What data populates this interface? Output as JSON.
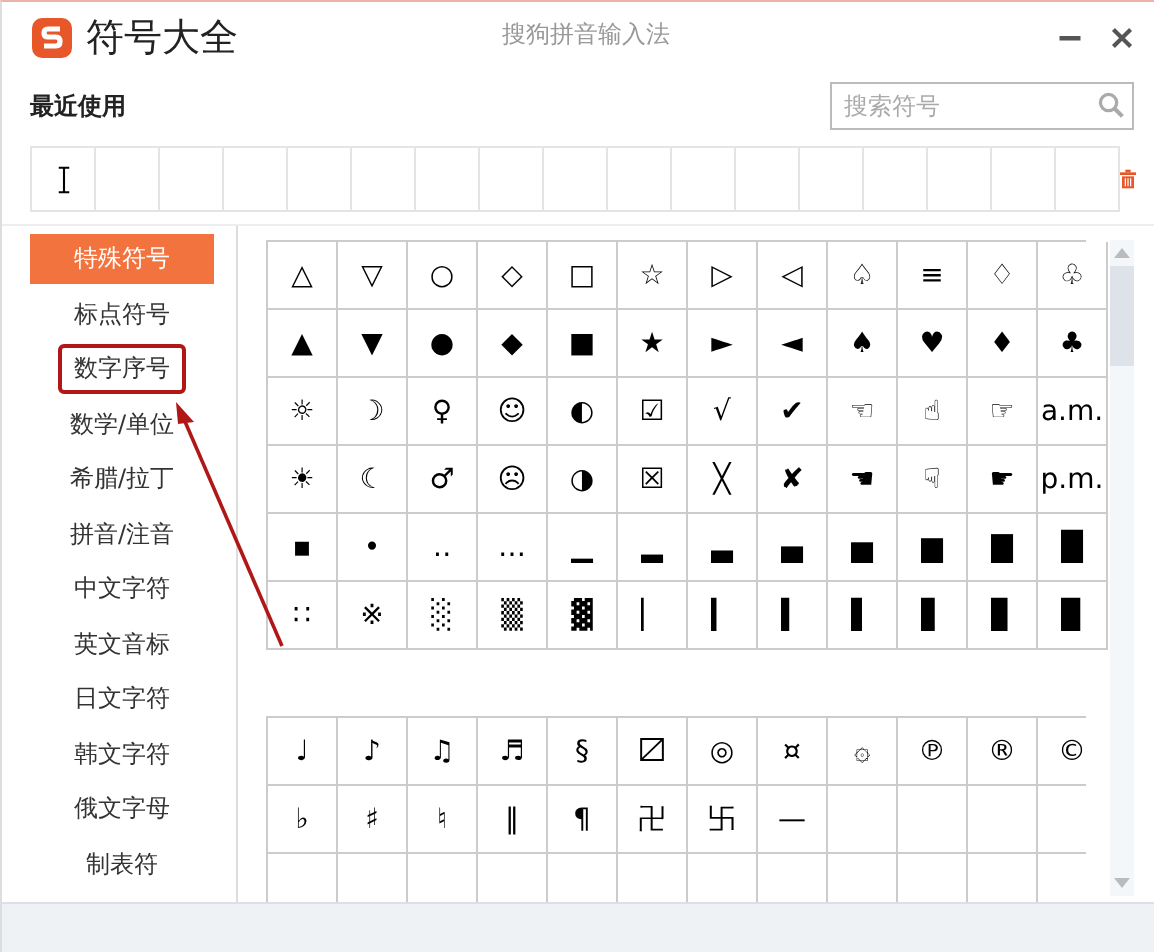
{
  "window": {
    "title": "符号大全",
    "app_name": "搜狗拼音输入法"
  },
  "recent": {
    "label": "最近使用"
  },
  "search": {
    "placeholder": "搜索符号"
  },
  "categories": [
    {
      "label": "特殊符号",
      "selected": true,
      "highlighted": false
    },
    {
      "label": "标点符号",
      "selected": false,
      "highlighted": false
    },
    {
      "label": "数字序号",
      "selected": false,
      "highlighted": true
    },
    {
      "label": "数学/单位",
      "selected": false,
      "highlighted": false
    },
    {
      "label": "希腊/拉丁",
      "selected": false,
      "highlighted": false
    },
    {
      "label": "拼音/注音",
      "selected": false,
      "highlighted": false
    },
    {
      "label": "中文字符",
      "selected": false,
      "highlighted": false
    },
    {
      "label": "英文音标",
      "selected": false,
      "highlighted": false
    },
    {
      "label": "日文字符",
      "selected": false,
      "highlighted": false
    },
    {
      "label": "韩文字符",
      "selected": false,
      "highlighted": false
    },
    {
      "label": "俄文字母",
      "selected": false,
      "highlighted": false
    },
    {
      "label": "制表符",
      "selected": false,
      "highlighted": false
    }
  ],
  "symbol_groups": [
    {
      "rows": [
        [
          "△",
          "▽",
          "○",
          "◇",
          "□",
          "☆",
          "▷",
          "◁",
          "♤",
          "≡",
          "♢",
          "♧"
        ],
        [
          "▲",
          "▼",
          "●",
          "◆",
          "■",
          "★",
          "►",
          "◄",
          "♠",
          "♥",
          "♦",
          "♣"
        ],
        [
          "☼",
          "☽",
          "♀",
          "☺",
          "◐",
          "☑",
          "√",
          "✔",
          "☜",
          "☝",
          "☞",
          "a.m."
        ],
        [
          "☀",
          "☾",
          "♂",
          "☹",
          "◑",
          "☒",
          "╳",
          "✘",
          "☚",
          "☟",
          "☛",
          "p.m."
        ],
        [
          "▪",
          "•",
          "‥",
          "…",
          "▁",
          "▂",
          "▃",
          "▄",
          "▅",
          "▆",
          "▇",
          "█"
        ],
        [
          "∷",
          "※",
          "░",
          "▒",
          "▓",
          "▏",
          "▎",
          "▍",
          "▌",
          "▋",
          "▊",
          "▉"
        ]
      ]
    },
    {
      "rows": [
        [
          "♩",
          "♪",
          "♫",
          "♬",
          "§",
          "〼",
          "◎",
          "¤",
          "۞",
          "℗",
          "®",
          "©"
        ],
        [
          "♭",
          "♯",
          "♮",
          "‖",
          "¶",
          "卍",
          "卐",
          "—"
        ]
      ]
    }
  ]
}
